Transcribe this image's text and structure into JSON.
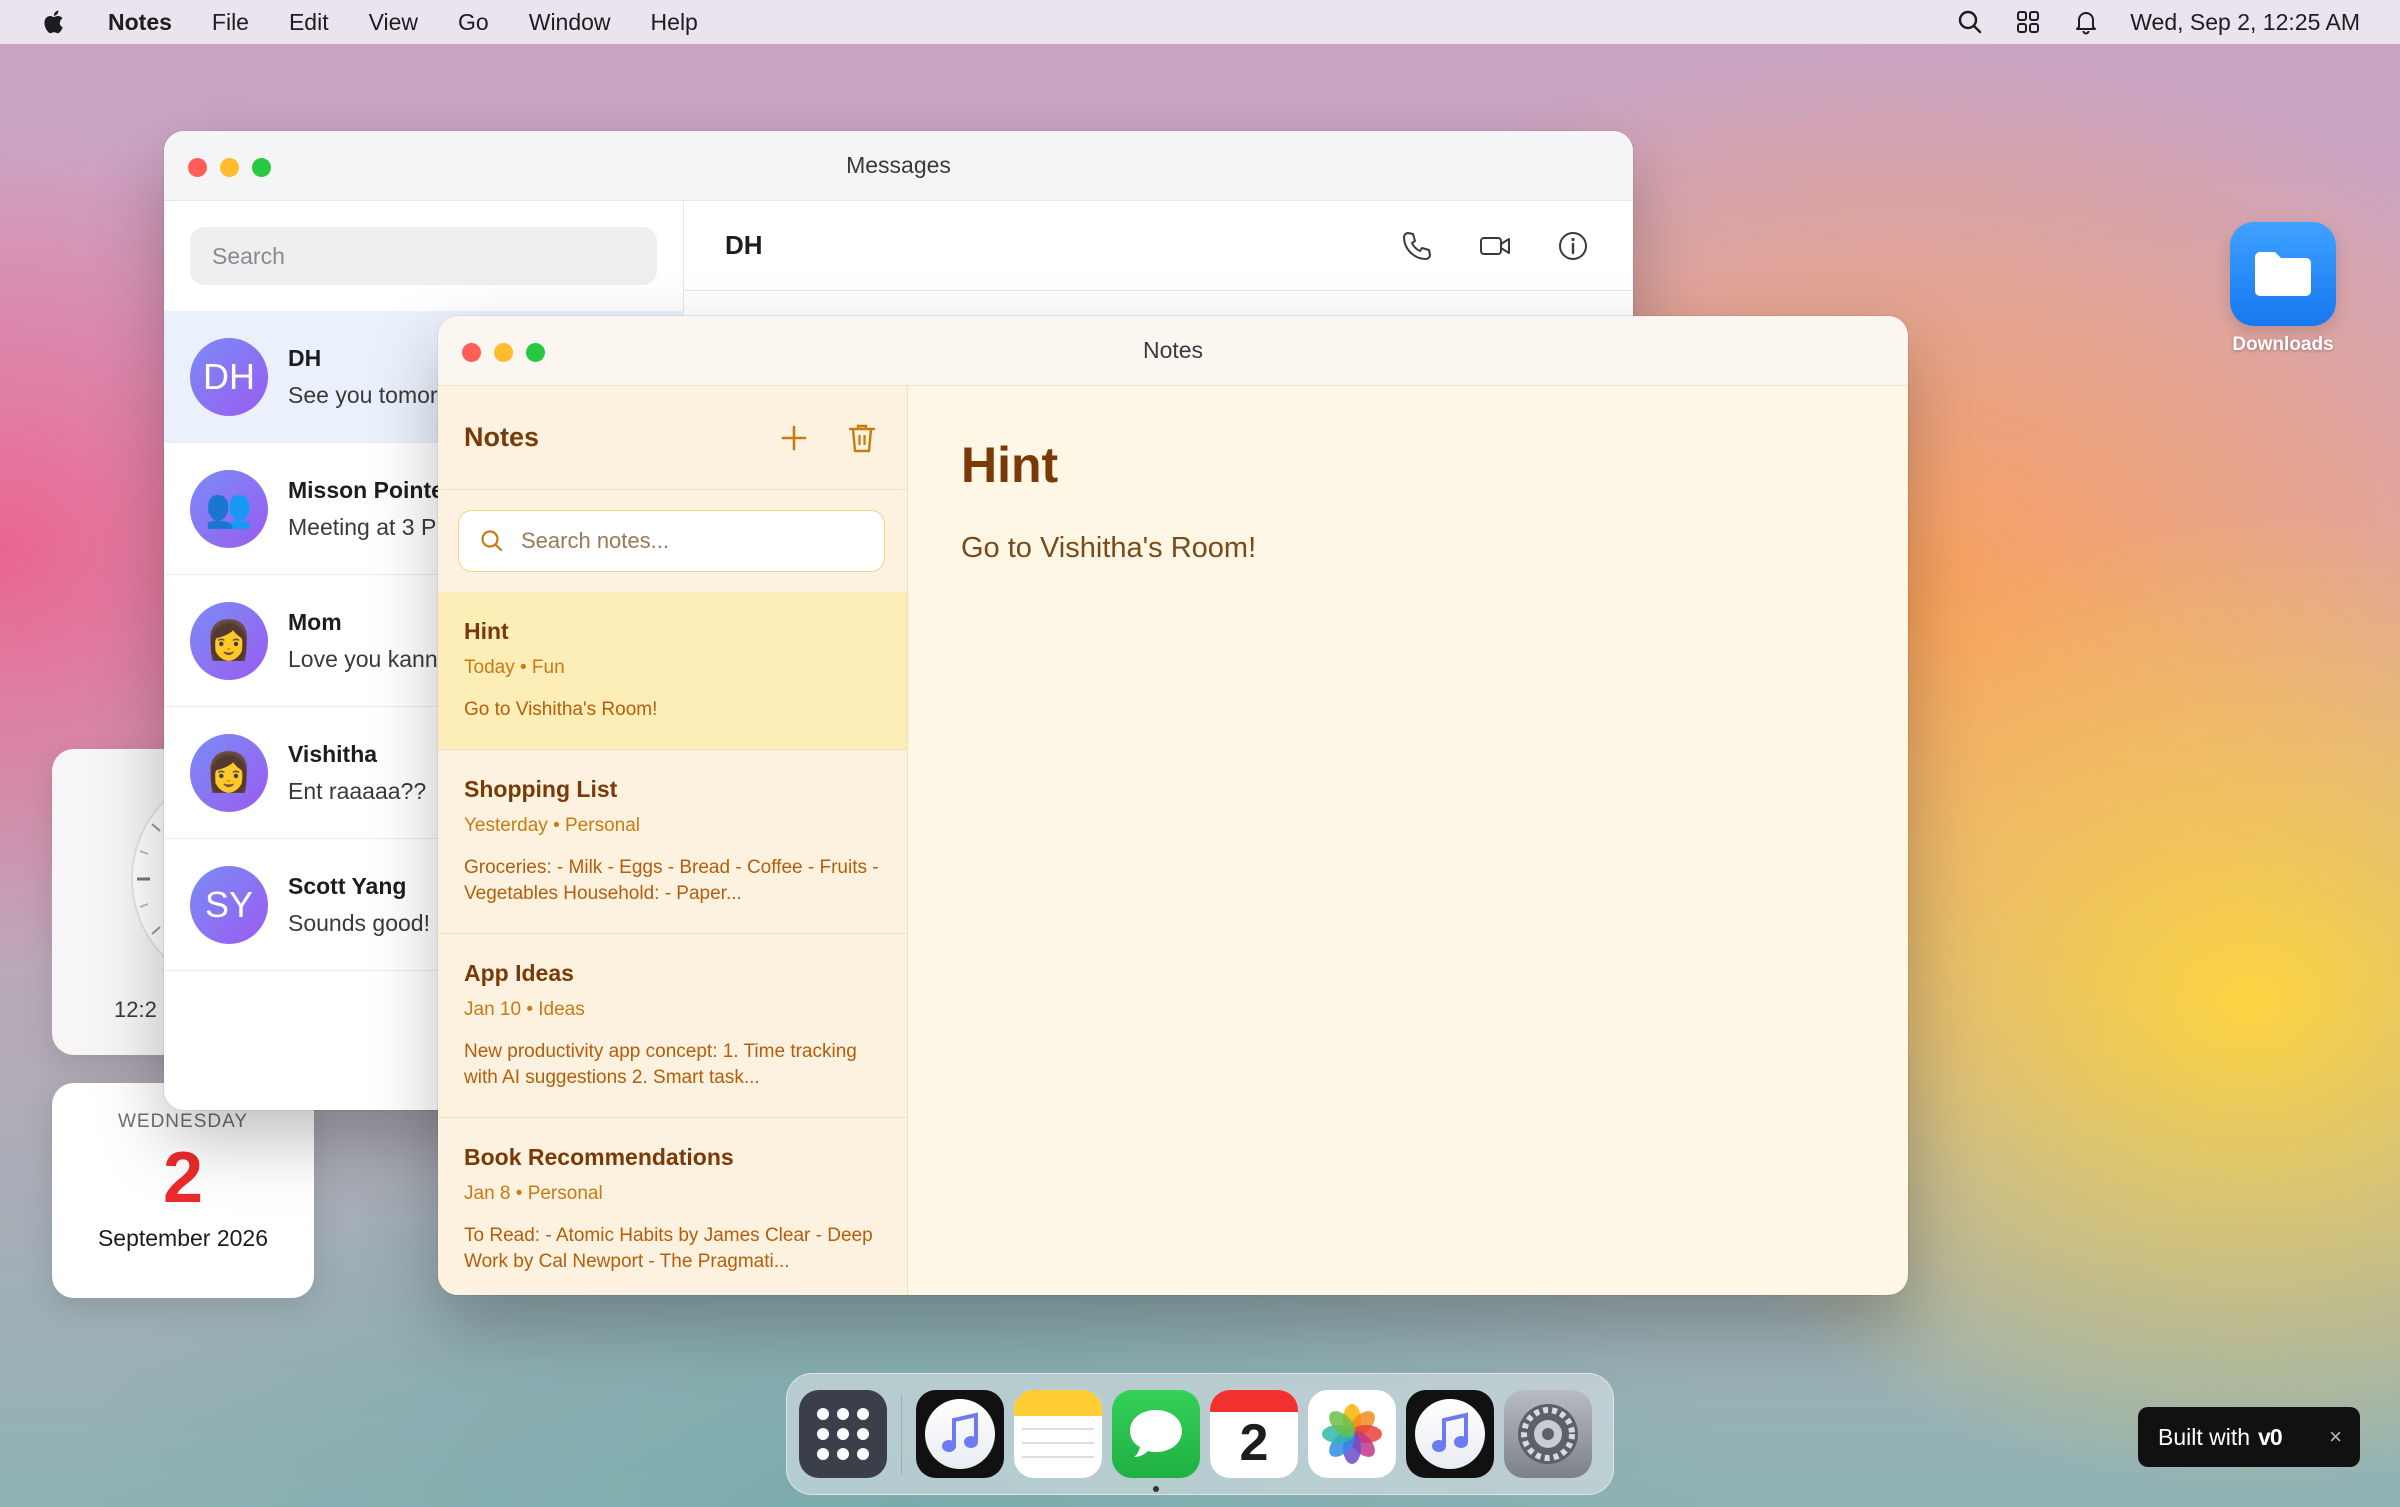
{
  "menubar": {
    "app_name": "Notes",
    "menus": [
      "File",
      "Edit",
      "View",
      "Go",
      "Window",
      "Help"
    ],
    "datetime": "Wed, Sep 2, 12:25 AM",
    "icons": [
      "search-icon",
      "control-center-icon",
      "bell-icon"
    ]
  },
  "messages_window": {
    "title": "Messages",
    "search_placeholder": "Search",
    "conversations": [
      {
        "name": "DH",
        "preview": "See you tomor",
        "avatar": "DH",
        "active": true
      },
      {
        "name": "Misson Pointe",
        "preview": "Meeting at 3 P",
        "avatar": "👥"
      },
      {
        "name": "Mom",
        "preview": "Love you kann",
        "avatar": "👩"
      },
      {
        "name": "Vishitha",
        "preview": "Ent raaaaa??",
        "avatar": "👩"
      },
      {
        "name": "Scott Yang",
        "preview": "Sounds good!",
        "avatar": "SY"
      }
    ],
    "header": {
      "contact": "DH"
    }
  },
  "notes_window": {
    "title": "Notes",
    "sidebar_title": "Notes",
    "search_placeholder": "Search notes...",
    "notes": [
      {
        "title": "Hint",
        "meta": "Today • Fun",
        "preview": "Go to Vishitha's Room!",
        "active": true
      },
      {
        "title": "Shopping List",
        "meta": "Yesterday • Personal",
        "preview": "Groceries: - Milk - Eggs - Bread - Coffee - Fruits - Vegetables Household: - Paper..."
      },
      {
        "title": "App Ideas",
        "meta": "Jan 10 • Ideas",
        "preview": "New productivity app concept: 1. Time tracking with AI suggestions 2. Smart task..."
      },
      {
        "title": "Book Recommendations",
        "meta": "Jan 8 • Personal",
        "preview": "To Read: - Atomic Habits by James Clear - Deep Work by Cal Newport - The Pragmati..."
      }
    ],
    "editor": {
      "title": "Hint",
      "body": "Go to Vishitha's Room!"
    }
  },
  "widgets": {
    "clock": {
      "digital": "12:2"
    },
    "calendar": {
      "weekday": "WEDNESDAY",
      "day": "2",
      "month_year": "September 2026"
    }
  },
  "desktop": {
    "downloads_label": "Downloads"
  },
  "dock": {
    "apps": [
      "launchpad-icon",
      "music-icon",
      "notes-icon",
      "messages-icon",
      "calendar-icon",
      "photos-icon",
      "music-icon",
      "system-settings-icon"
    ],
    "calendar_day": "2"
  },
  "toast": {
    "text": "Built with",
    "logo": "v0",
    "close": "×"
  },
  "colors": {
    "notes_accent": "#c97a12",
    "notes_title": "#7a3a08",
    "calendar_red": "#ee2a2a",
    "messages_active": "#eaf1fd"
  }
}
